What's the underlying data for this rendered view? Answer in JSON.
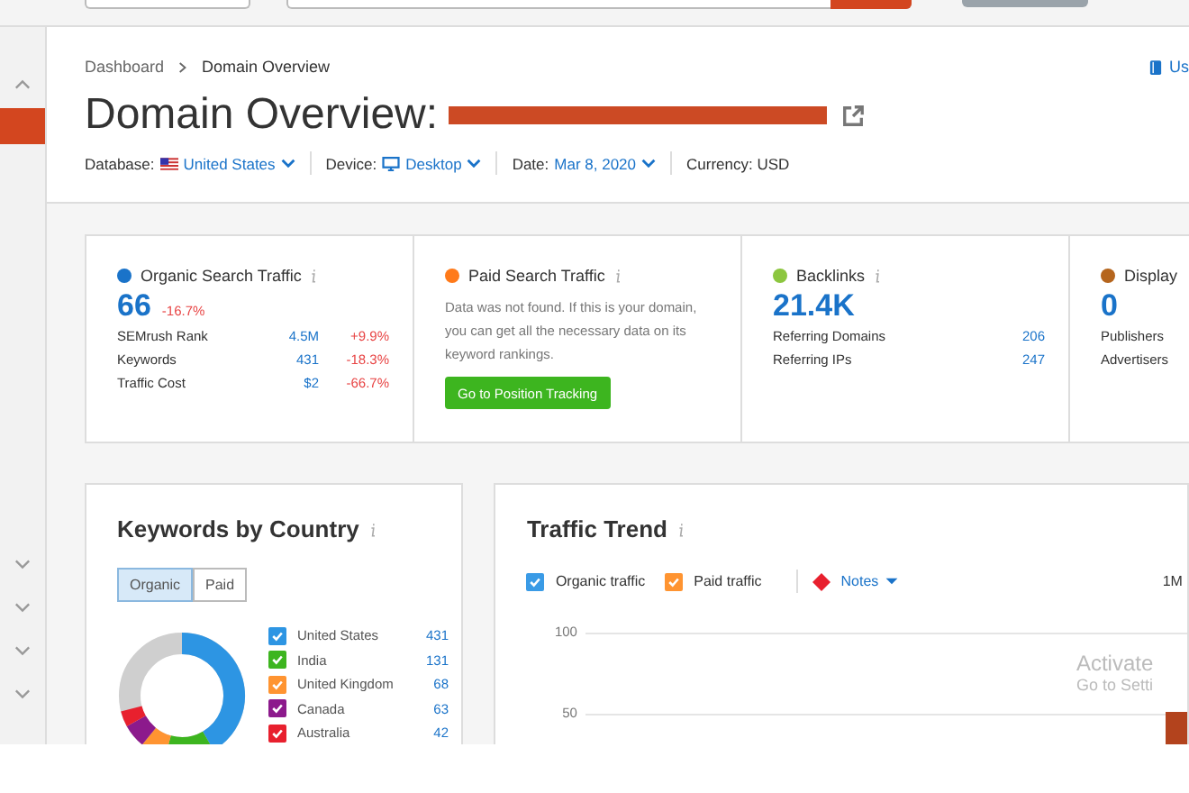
{
  "breadcrumb": [
    {
      "label": "Dashboard"
    },
    {
      "label": "Domain Overview"
    }
  ],
  "user_manual_link": "Us",
  "title": "Domain Overview:",
  "meta": [
    {
      "label": "Database:",
      "value": "United States",
      "kind": "flag"
    },
    {
      "label": "Device:",
      "value": "Desktop",
      "kind": "device"
    },
    {
      "label": "Date:",
      "value": "Mar 8, 2020",
      "kind": "plain"
    },
    {
      "label": "Currency: USD",
      "kind": "static"
    }
  ],
  "summary": [
    {
      "title": "Organic Search Traffic",
      "info": true,
      "color": "#1a73c9",
      "value": "66",
      "change": "-16.7%",
      "rows": [
        {
          "label": "SEMrush Rank",
          "value": "4.5M",
          "change": "+9.9%"
        },
        {
          "label": "Keywords",
          "value": "431",
          "change": "-18.3%"
        },
        {
          "label": "Traffic Cost",
          "value": "$2",
          "change": "-66.7%"
        }
      ]
    },
    {
      "title": "Paid Search Traffic",
      "info": true,
      "color": "#ff7a1a",
      "message": "Data was not found. If this is your domain, you can get all the necessary data on its keyword rankings.",
      "button": "Go to Position Tracking"
    },
    {
      "title": "Backlinks",
      "info": true,
      "color": "#8cc63f",
      "value": "21.4K",
      "rows": [
        {
          "label": "Referring Domains",
          "value": "206"
        },
        {
          "label": "Referring IPs",
          "value": "247"
        }
      ]
    },
    {
      "title": "Display",
      "color": "#b5651d",
      "value": "0",
      "rows": [
        {
          "label": "Publishers"
        },
        {
          "label": "Advertisers"
        }
      ]
    }
  ],
  "keywords_by_country": {
    "title": "Keywords by Country",
    "toggle": [
      {
        "label": "Organic",
        "selected": true
      },
      {
        "label": "Paid",
        "selected": false
      }
    ],
    "countries": [
      {
        "name": "United States",
        "value": "431",
        "color": "#2d95e3",
        "checked": true
      },
      {
        "name": "India",
        "value": "131",
        "color": "#3db51f",
        "checked": true
      },
      {
        "name": "United Kingdom",
        "value": "68",
        "color": "#ff9431",
        "checked": true
      },
      {
        "name": "Canada",
        "value": "63",
        "color": "#8c1a8c",
        "checked": true
      },
      {
        "name": "Australia",
        "value": "42",
        "color": "#e8202e",
        "checked": true
      }
    ]
  },
  "traffic_trend": {
    "title": "Traffic Trend",
    "series": [
      {
        "label": "Organic traffic",
        "color": "#3a9be6",
        "checked": true
      },
      {
        "label": "Paid traffic",
        "color": "#ff9431",
        "checked": true
      }
    ],
    "notes": "Notes",
    "period": "1M",
    "y_ticks": [
      "100",
      "50"
    ]
  },
  "os_overlay": {
    "title": "Activate",
    "subtitle": "Go to Setti"
  }
}
